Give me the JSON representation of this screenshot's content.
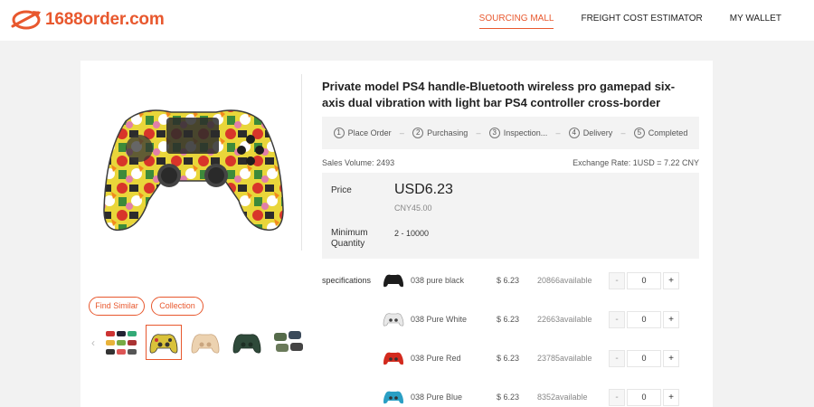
{
  "header": {
    "logo_text": "1688order.com",
    "nav": [
      "SOURCING MALL",
      "FREIGHT COST ESTIMATOR",
      "MY WALLET"
    ],
    "active_nav": "SOURCING MALL"
  },
  "product": {
    "title": "Private model PS4 handle-Bluetooth wireless pro gamepad six-axis dual vibration with light bar PS4 controller cross-border",
    "steps": [
      {
        "num": "1",
        "label": "Place Order"
      },
      {
        "num": "2",
        "label": "Purchasing"
      },
      {
        "num": "3",
        "label": "Inspection..."
      },
      {
        "num": "4",
        "label": "Delivery"
      },
      {
        "num": "5",
        "label": "Completed"
      }
    ],
    "sales_volume_label": "Sales Volume:",
    "sales_volume": "2493",
    "exchange_rate": "Exchange Rate: 1USD = 7.22 CNY",
    "price_label": "Price",
    "price_usd": "USD6.23",
    "price_cny": "CNY45.00",
    "min_qty_label": "Minimum Quantity",
    "min_qty": "2 - 10000"
  },
  "gallery": {
    "find_similar": "Find Similar",
    "collection": "Collection",
    "prev_arrow": "‹",
    "thumbnails": [
      "assorted-controllers",
      "graffiti-controller",
      "cream-controller",
      "dark-green-controller",
      "camo-controller-set"
    ],
    "selected_index": 1
  },
  "specs": {
    "label": "specifications",
    "rows": [
      {
        "name": "038 pure black",
        "price": "$ 6.23",
        "available": "20866available",
        "qty": "0",
        "color": "#1c1c1c"
      },
      {
        "name": "038 Pure White",
        "price": "$ 6.23",
        "available": "22663available",
        "qty": "0",
        "color": "#e8e8e8"
      },
      {
        "name": "038 Pure Red",
        "price": "$ 6.23",
        "available": "23785available",
        "qty": "0",
        "color": "#d32a1e"
      },
      {
        "name": "038 Pure Blue",
        "price": "$ 6.23",
        "available": "8352available",
        "qty": "0",
        "color": "#2a9fc4"
      }
    ],
    "minus": "-",
    "plus": "+"
  },
  "colors": {
    "brand": "#e8582e",
    "panel": "#f3f3f3"
  }
}
